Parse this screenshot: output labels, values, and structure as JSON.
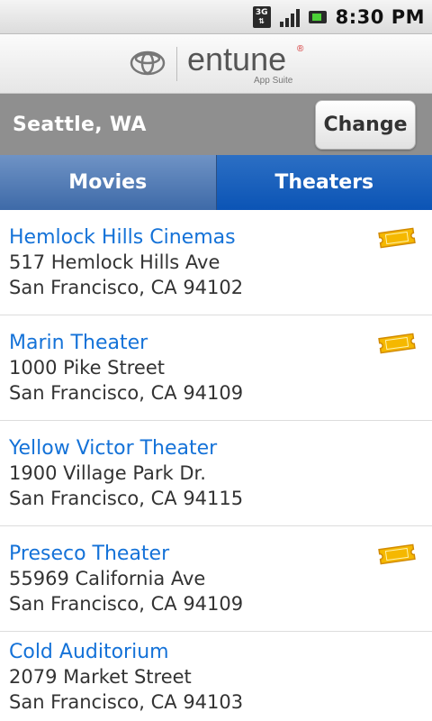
{
  "status_bar": {
    "network": "3G",
    "time": "8:30 PM",
    "icons": [
      "3g-icon",
      "signal-icon",
      "battery-icon"
    ]
  },
  "header": {
    "brand": "entune",
    "registered": "®",
    "subtitle": "App Suite",
    "emblem": "toyota-emblem-icon"
  },
  "location": {
    "label": "Seattle, WA",
    "change_label": "Change"
  },
  "tabs": [
    {
      "label": "Movies",
      "selected": false
    },
    {
      "label": "Theaters",
      "selected": true
    }
  ],
  "theaters": [
    {
      "name": "Hemlock Hills Cinemas",
      "address1": "517 Hemlock Hills Ave",
      "address2": "San Francisco, CA 94102",
      "tickets": true
    },
    {
      "name": "Marin Theater",
      "address1": "1000 Pike Street",
      "address2": "San Francisco, CA 94109",
      "tickets": true
    },
    {
      "name": "Yellow Victor Theater",
      "address1": "1900 Village Park Dr.",
      "address2": "San Francisco, CA 94115",
      "tickets": false
    },
    {
      "name": "Preseco Theater",
      "address1": "55969 California Ave",
      "address2": "San Francisco, CA 94109",
      "tickets": true
    },
    {
      "name": "Cold Auditorium",
      "address1": "2079 Market Street",
      "address2": "San Francisco, CA 94103",
      "tickets": false
    }
  ],
  "colors": {
    "link_blue": "#1472d8",
    "tab_selected": "#0b54b5",
    "tab_unselected": "#3e6aa8",
    "location_bar": "#8f8f8f",
    "ticket_yellow": "#f5b800"
  }
}
